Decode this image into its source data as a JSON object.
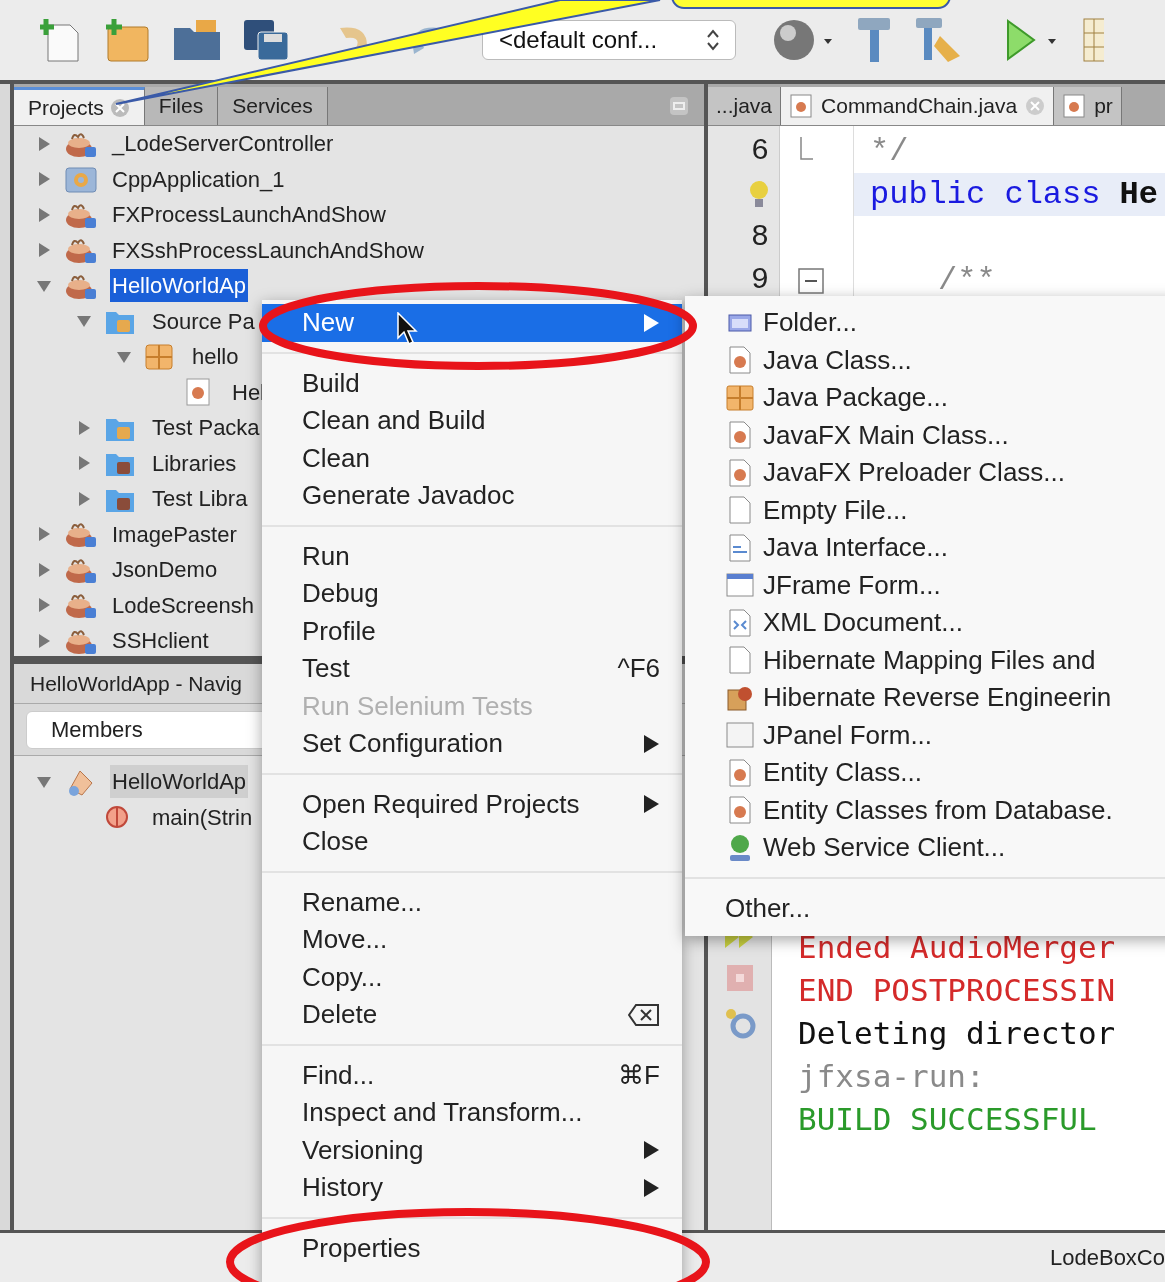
{
  "toolbar": {
    "config": "<default conf..."
  },
  "projects_panel": {
    "tabs": [
      {
        "label": "Projects",
        "selected": true,
        "closable": true
      },
      {
        "label": "Files",
        "selected": false,
        "closable": false
      },
      {
        "label": "Services",
        "selected": false,
        "closable": false
      }
    ],
    "tree": [
      {
        "label": "_LodeServerController",
        "kind": "project",
        "expanded": false,
        "selected": false
      },
      {
        "label": "CppApplication_1",
        "kind": "cpp",
        "expanded": false,
        "selected": false
      },
      {
        "label": "FXProcessLaunchAndShow",
        "kind": "project",
        "expanded": false,
        "selected": false
      },
      {
        "label": "FXSshProcessLaunchAndShow",
        "kind": "project",
        "expanded": false,
        "selected": false
      },
      {
        "label": "HelloWorldAp",
        "kind": "project",
        "expanded": true,
        "selected": true,
        "children": [
          {
            "label": "Source Pa",
            "kind": "folder",
            "expanded": true,
            "selected": false,
            "children": [
              {
                "label": "hello",
                "kind": "package",
                "expanded": true,
                "selected": false,
                "children": [
                  {
                    "label": "Hel",
                    "kind": "java",
                    "selected": false
                  }
                ]
              }
            ]
          },
          {
            "label": "Test Packa",
            "kind": "folder",
            "expanded": false,
            "selected": false
          },
          {
            "label": "Libraries",
            "kind": "library",
            "expanded": false,
            "selected": false
          },
          {
            "label": "Test Libra",
            "kind": "library",
            "expanded": false,
            "selected": false
          }
        ]
      },
      {
        "label": "ImagePaster",
        "kind": "project",
        "expanded": false,
        "selected": false
      },
      {
        "label": "JsonDemo",
        "kind": "project",
        "expanded": false,
        "selected": false
      },
      {
        "label": "LodeScreensh",
        "kind": "project",
        "expanded": false,
        "selected": false
      },
      {
        "label": "SSHclient",
        "kind": "project",
        "expanded": false,
        "selected": false
      }
    ]
  },
  "navigator": {
    "title": "HelloWorldApp - Navig",
    "filter": "Members",
    "tree": [
      {
        "label": "HelloWorldAp",
        "kind": "class",
        "expanded": true,
        "selected": true,
        "children": [
          {
            "label": "main(Strin",
            "kind": "method",
            "selected": false
          }
        ]
      }
    ]
  },
  "editor": {
    "tabs": [
      {
        "label": "...java",
        "selected": false,
        "file_icon": false,
        "closable": false
      },
      {
        "label": "CommandChain.java",
        "selected": true,
        "file_icon": true,
        "closable": true
      },
      {
        "label": "pr",
        "selected": false,
        "file_icon": true,
        "closable": false
      }
    ],
    "lines": [
      {
        "kind": "fold_end",
        "number": "6",
        "current": false,
        "hint": false,
        "segments": [
          {
            "text": "*/",
            "kind": "comment"
          }
        ]
      },
      {
        "kind": "plain",
        "current": true,
        "hint": true,
        "segments": [
          {
            "text": "public class",
            "kind": "keyword"
          },
          {
            "text": "He",
            "kind": "plain"
          }
        ]
      },
      {
        "kind": "plain",
        "number": "8",
        "current": false,
        "hint": false
      },
      {
        "kind": "fold_start",
        "number": "9",
        "current": false,
        "hint": false,
        "segments": [
          {
            "text": "/**",
            "kind": "comment"
          }
        ]
      }
    ]
  },
  "output": {
    "lines": [
      {
        "text": "Ended AudioMerger",
        "kind": "error"
      },
      {
        "text": "END POSTPROCESSIN",
        "kind": "error"
      },
      {
        "text": "Deleting director",
        "kind": "plain"
      },
      {
        "text": "jfxsa-run:",
        "kind": "muted"
      },
      {
        "text": "BUILD SUCCESSFUL",
        "kind": "success"
      }
    ]
  },
  "status_bar": {
    "text": "LodeBoxCo"
  },
  "context_menu": {
    "items": [
      {
        "kind": "item",
        "label": "New",
        "submenu": true,
        "selected": true,
        "disabled": false
      },
      {
        "kind": "separator"
      },
      {
        "kind": "item",
        "label": "Build",
        "submenu": false,
        "selected": false,
        "disabled": false
      },
      {
        "kind": "item",
        "label": "Clean and Build",
        "submenu": false,
        "selected": false,
        "disabled": false
      },
      {
        "kind": "item",
        "label": "Clean",
        "submenu": false,
        "selected": false,
        "disabled": false
      },
      {
        "kind": "item",
        "label": "Generate Javadoc",
        "submenu": false,
        "selected": false,
        "disabled": false
      },
      {
        "kind": "separator"
      },
      {
        "kind": "item",
        "label": "Run",
        "submenu": false,
        "selected": false,
        "disabled": false
      },
      {
        "kind": "item",
        "label": "Debug",
        "submenu": false,
        "selected": false,
        "disabled": false
      },
      {
        "kind": "item",
        "label": "Profile",
        "submenu": false,
        "selected": false,
        "disabled": false
      },
      {
        "kind": "item",
        "label": "Test",
        "shortcut": "^F6",
        "submenu": false,
        "selected": false,
        "disabled": false
      },
      {
        "kind": "item",
        "label": "Run Selenium Tests",
        "submenu": false,
        "selected": false,
        "disabled": true
      },
      {
        "kind": "item",
        "label": "Set Configuration",
        "submenu": true,
        "selected": false,
        "disabled": false
      },
      {
        "kind": "separator"
      },
      {
        "kind": "item",
        "label": "Open Required Projects",
        "submenu": true,
        "selected": false,
        "disabled": false
      },
      {
        "kind": "item",
        "label": "Close",
        "submenu": false,
        "selected": false,
        "disabled": false
      },
      {
        "kind": "separator"
      },
      {
        "kind": "item",
        "label": "Rename...",
        "submenu": false,
        "selected": false,
        "disabled": false
      },
      {
        "kind": "item",
        "label": "Move...",
        "submenu": false,
        "selected": false,
        "disabled": false
      },
      {
        "kind": "item",
        "label": "Copy...",
        "submenu": false,
        "selected": false,
        "disabled": false
      },
      {
        "kind": "item",
        "label": "Delete",
        "key_icon": true,
        "submenu": false,
        "selected": false,
        "disabled": false
      },
      {
        "kind": "separator"
      },
      {
        "kind": "item",
        "label": "Find...",
        "shortcut": "⌘F",
        "submenu": false,
        "selected": false,
        "disabled": false
      },
      {
        "kind": "item",
        "label": "Inspect and Transform...",
        "submenu": false,
        "selected": false,
        "disabled": false
      },
      {
        "kind": "item",
        "label": "Versioning",
        "submenu": true,
        "selected": false,
        "disabled": false
      },
      {
        "kind": "item",
        "label": "History",
        "submenu": true,
        "selected": false,
        "disabled": false
      },
      {
        "kind": "separator"
      },
      {
        "kind": "item",
        "label": "Properties",
        "submenu": false,
        "selected": false,
        "disabled": false
      }
    ]
  },
  "new_submenu": {
    "items": [
      {
        "kind": "folder",
        "label": "Folder..."
      },
      {
        "kind": "class",
        "label": "Java Class..."
      },
      {
        "kind": "package",
        "label": "Java Package..."
      },
      {
        "kind": "class",
        "label": "JavaFX Main Class..."
      },
      {
        "kind": "class",
        "label": "JavaFX Preloader Class..."
      },
      {
        "kind": "file",
        "label": "Empty File..."
      },
      {
        "kind": "interface",
        "label": "Java Interface..."
      },
      {
        "kind": "form",
        "label": "JFrame Form..."
      },
      {
        "kind": "xml",
        "label": "XML Document..."
      },
      {
        "kind": "file",
        "label": "Hibernate Mapping Files and"
      },
      {
        "kind": "hibernate",
        "label": "Hibernate Reverse Engineerin"
      },
      {
        "kind": "panel",
        "label": "JPanel Form..."
      },
      {
        "kind": "class",
        "label": "Entity Class..."
      },
      {
        "kind": "class",
        "label": "Entity Classes from Database."
      },
      {
        "kind": "webservice",
        "label": "Web Service Client..."
      },
      {
        "kind": "separator"
      },
      {
        "kind": "plain",
        "label": "Other..."
      }
    ]
  }
}
